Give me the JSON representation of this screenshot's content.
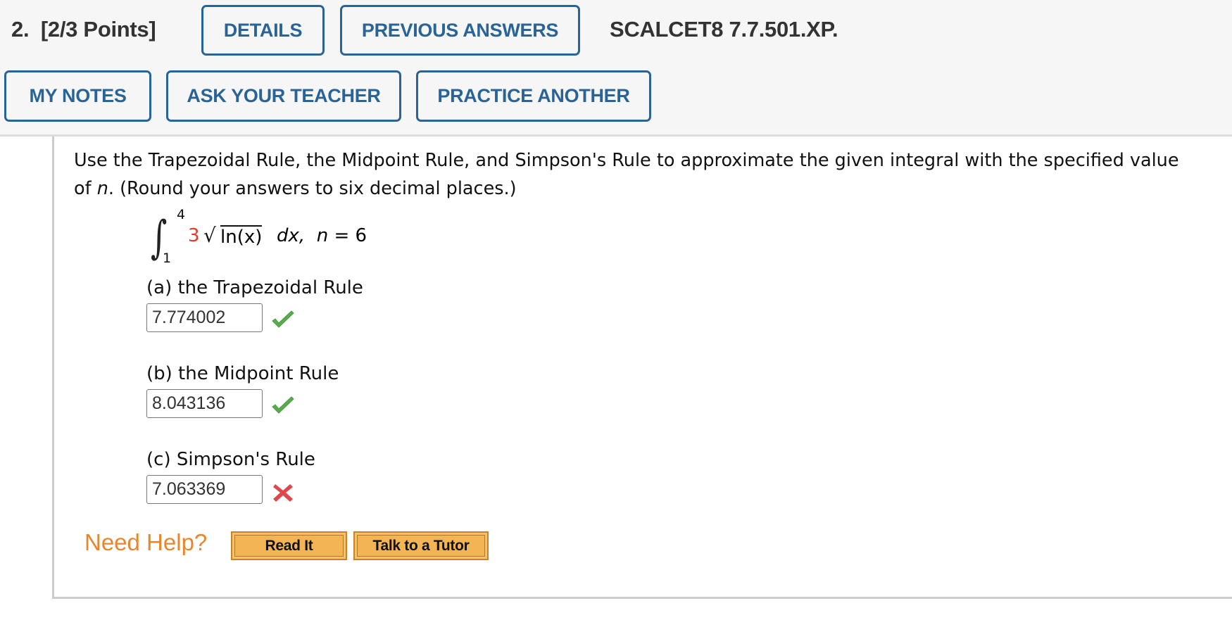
{
  "header": {
    "question_number": "2.",
    "points": "[2/3 Points]",
    "buttons": {
      "details": "DETAILS",
      "previous_answers": "PREVIOUS ANSWERS",
      "my_notes": "MY NOTES",
      "ask_teacher": "ASK YOUR TEACHER",
      "practice_another": "PRACTICE ANOTHER"
    },
    "problem_code": "SCALCET8 7.7.501.XP."
  },
  "question": {
    "text_line1": "Use the Trapezoidal Rule, the Midpoint Rule, and Simpson's Rule to approximate the given integral with the specified value",
    "text_line2_prefix": "of ",
    "text_line2_var": "n",
    "text_line2_suffix": ". (Round your answers to six decimal places.)",
    "integral": {
      "upper_limit": "4",
      "lower_limit": "1",
      "coefficient": "3",
      "radical": "√",
      "radicand": "ln(x)",
      "differential": "dx,",
      "n_label": "n",
      "n_value": "= 6"
    }
  },
  "parts": [
    {
      "label": "(a) the Trapezoidal Rule",
      "value": "7.774002",
      "status": "correct",
      "icon": "check-icon"
    },
    {
      "label": "(b) the Midpoint Rule",
      "value": "8.043136",
      "status": "correct",
      "icon": "check-icon"
    },
    {
      "label": "(c) Simpson's Rule",
      "value": "7.063369",
      "status": "incorrect",
      "icon": "x-icon"
    }
  ],
  "help": {
    "label": "Need Help?",
    "read_it": "Read It",
    "talk_to_tutor": "Talk to a Tutor"
  },
  "colors": {
    "button_blue": "#2a6496",
    "correct_green": "#5aab4e",
    "incorrect_red": "#e0474c",
    "help_orange": "#e8862e",
    "coefficient_red": "#e03a2a"
  }
}
